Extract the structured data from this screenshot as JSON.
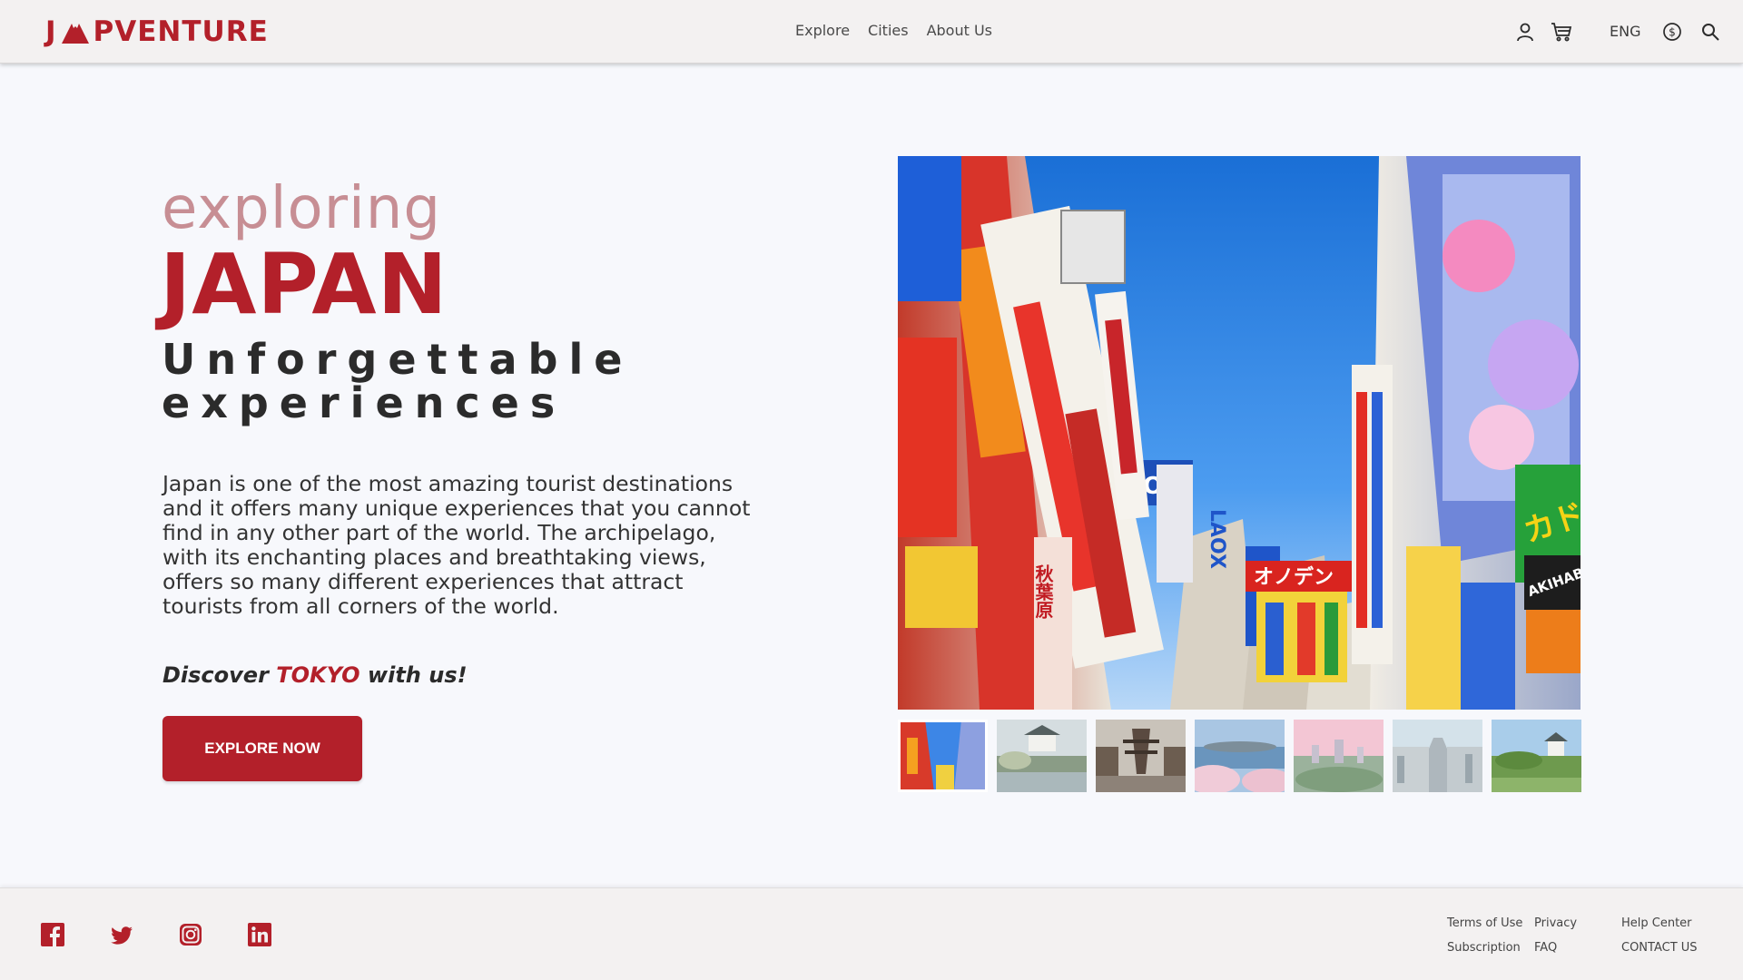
{
  "brand": {
    "logo_left": "J",
    "logo_right": "PVENTURE",
    "accent": "#b3202a"
  },
  "nav": {
    "items": [
      "Explore",
      "Cities",
      "About Us"
    ]
  },
  "header_right": {
    "language": "ENG",
    "icons": [
      "user-icon",
      "cart-icon",
      "currency-icon",
      "search-icon"
    ]
  },
  "hero": {
    "eyebrow": "exploring",
    "title": "JAPAN",
    "subtitle_line1": "Unforgettable",
    "subtitle_line2": "experiences",
    "description": "Japan is one of the most amazing tourist destinations and it offers many unique experiences that you cannot find in any other part of the world. The archipelago, with its enchanting places and breathtaking views, offers so many different experiences that attract tourists from all corners of the world.",
    "discover_prefix": "Discover",
    "discover_city": "TOKYO",
    "discover_suffix": "with us!",
    "cta_label": "EXPLORE NOW"
  },
  "gallery": {
    "main_photo_signs": [
      "オノデン",
      "LAOX",
      "ON",
      "秋葉原",
      "AKIHAB"
    ],
    "thumbnails": [
      "tokyo-akihabara",
      "castle-garden",
      "pagoda-street",
      "cherry-blossom-lake",
      "city-skyline",
      "city-avenue",
      "castle-park"
    ],
    "active_index": 0
  },
  "footer": {
    "social": [
      "facebook-icon",
      "twitter-icon",
      "instagram-icon",
      "linkedin-icon"
    ],
    "links": {
      "terms": "Terms of Use",
      "privacy": "Privacy",
      "help": "Help Center",
      "subscription": "Subscription",
      "faq": "FAQ",
      "contact": "CONTACT US"
    }
  }
}
